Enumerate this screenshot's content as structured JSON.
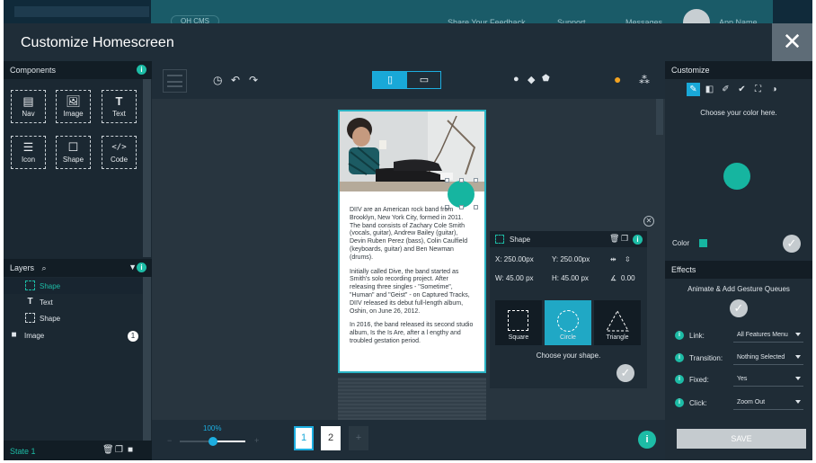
{
  "app_header": {
    "brand": "OH CMS",
    "feedback": "Share Your Feedback",
    "support": "Support",
    "messages": "Messages",
    "user": "App Name"
  },
  "modal": {
    "title": "Customize Homescreen",
    "close_icon": "close-icon"
  },
  "components": {
    "title": "Components",
    "items": [
      {
        "label": "Nav",
        "icon": "nav-icon"
      },
      {
        "label": "Image",
        "icon": "image-icon"
      },
      {
        "label": "Text",
        "icon": "text-icon"
      },
      {
        "label": "Icon",
        "icon": "list-icon"
      },
      {
        "label": "Shape",
        "icon": "shape-icon"
      },
      {
        "label": "Code",
        "icon": "code-icon"
      }
    ]
  },
  "layers": {
    "title": "Layers",
    "items": [
      {
        "label": "Shape",
        "selected": true
      },
      {
        "label": "Text",
        "selected": false
      },
      {
        "label": "Shape",
        "selected": false
      },
      {
        "label": "Image",
        "selected": false,
        "count": "1"
      }
    ]
  },
  "state": {
    "label": "State 1"
  },
  "canvas": {
    "zoom": "100%",
    "zoom_level": 1.0,
    "pages": [
      "1",
      "2"
    ],
    "add_page": "+",
    "article": [
      "DIIV are an American rock band from Brooklyn, New York City, formed in 2011. The band consists of Zachary Cole Smith (vocals, guitar), Andrew Bailey (guitar), Devin Ruben Perez (bass), Colin Caulfield (keyboards, guitar) and Ben Newman (drums).",
      "Initially called Dive, the band started as Smith's solo recording project. After releasing three singles - \"Sometime\", \"Human\" and \"Geist\" - on Captured Tracks, DIIV released its debut full-length album, Oshin, on June 26, 2012.",
      "In 2016, the band released its second studio album, Is the Is Are, after a l engthy and troubled gestation period."
    ]
  },
  "shape_panel": {
    "title": "Shape",
    "x": "X: 250.00px",
    "y": "Y: 250.00px",
    "w": "W: 45.00 px",
    "h": "H: 45.00 px",
    "rotation": "0.00",
    "options": [
      {
        "label": "Square",
        "selected": false
      },
      {
        "label": "Circle",
        "selected": true
      },
      {
        "label": "Triangle",
        "selected": false
      }
    ],
    "hint": "Choose your shape."
  },
  "customize": {
    "title": "Customize",
    "hint": "Choose your color here.",
    "color_label": "Color",
    "swatch": "#16b5a0"
  },
  "effects": {
    "title": "Effects",
    "subtitle": "Animate & Add Gesture Queues",
    "rows": [
      {
        "label": "Link:",
        "value": "All Features Menu"
      },
      {
        "label": "Transition:",
        "value": "Nothing Selected"
      },
      {
        "label": "Fixed:",
        "value": "Yes"
      },
      {
        "label": "Click:",
        "value": "Zoom Out"
      }
    ],
    "save": "SAVE"
  },
  "colors": {
    "accent": "#1dbca6",
    "blue": "#19a8d8",
    "dark": "#1c2a35"
  }
}
